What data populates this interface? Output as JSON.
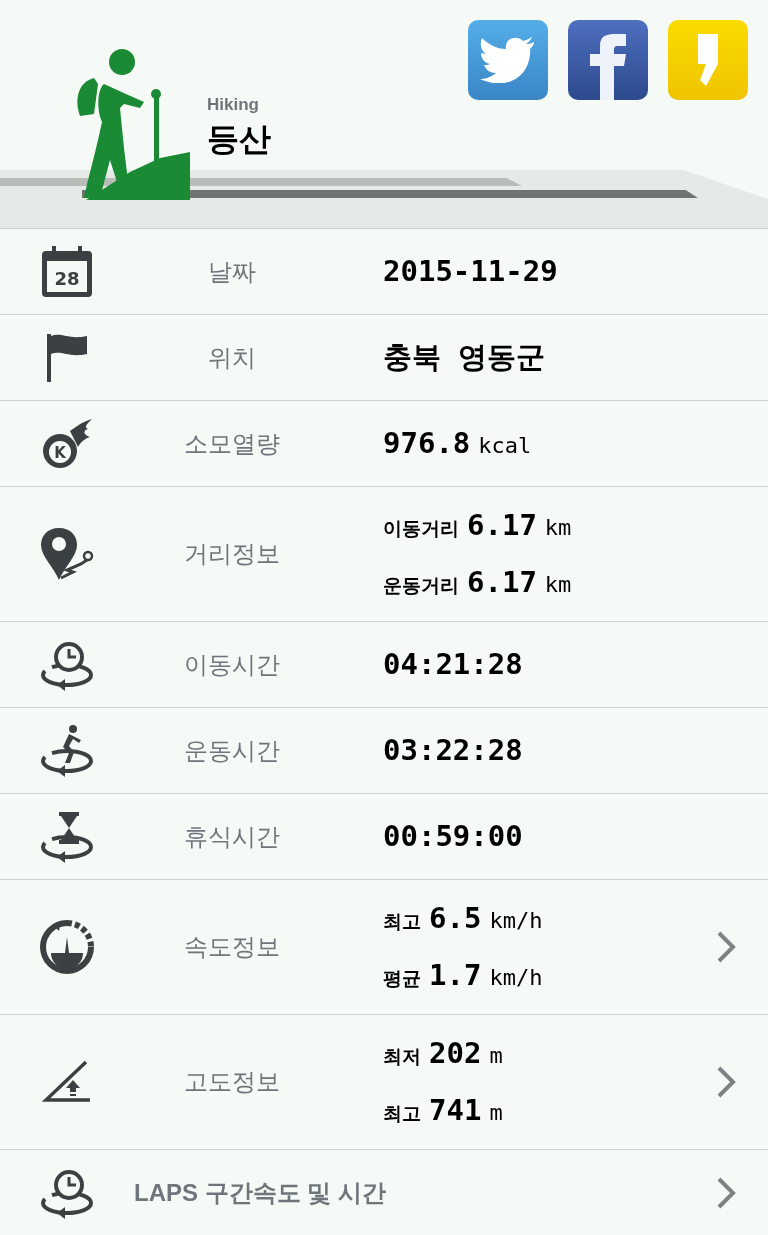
{
  "header": {
    "subtitle": "Hiking",
    "title": "등산"
  },
  "rows": [
    {
      "kind": "single",
      "label": "날짜",
      "value": "2015-11-29",
      "icon_text": "28",
      "chevron": false
    },
    {
      "kind": "single",
      "label": "위치",
      "value": "충북 영동군",
      "chevron": false
    },
    {
      "kind": "unit",
      "label": "소모열량",
      "icon_text": "K",
      "value": "976.8",
      "unit": "kcal",
      "chevron": false
    },
    {
      "kind": "pairs",
      "label": "거리정보",
      "pairs": [
        {
          "label": "이동거리",
          "value": "6.17",
          "unit": "km"
        },
        {
          "label": "운동거리",
          "value": "6.17",
          "unit": "km"
        }
      ],
      "chevron": false
    },
    {
      "kind": "single",
      "label": "이동시간",
      "value": "04:21:28",
      "chevron": false
    },
    {
      "kind": "single",
      "label": "운동시간",
      "value": "03:22:28",
      "chevron": false
    },
    {
      "kind": "single",
      "label": "휴식시간",
      "value": "00:59:00",
      "chevron": false
    },
    {
      "kind": "pairs",
      "label": "속도정보",
      "pairs": [
        {
          "label": "최고",
          "value": "6.5",
          "unit": "km/h"
        },
        {
          "label": "평균",
          "value": "1.7",
          "unit": "km/h"
        }
      ],
      "chevron": true
    },
    {
      "kind": "pairs",
      "label": "고도정보",
      "pairs": [
        {
          "label": "최저",
          "value": "202",
          "unit": "m"
        },
        {
          "label": "최고",
          "value": "741",
          "unit": "m"
        }
      ],
      "chevron": true
    },
    {
      "kind": "link",
      "label": "LAPS 구간속도 및 시간",
      "chevron": true
    }
  ]
}
